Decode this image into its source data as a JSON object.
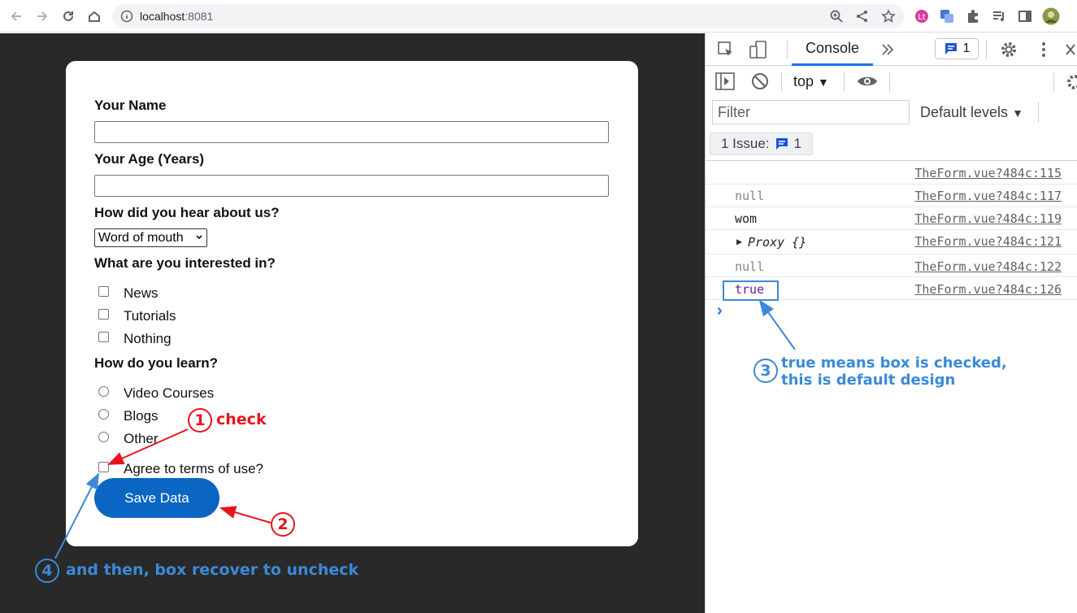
{
  "browser": {
    "url_host": "localhost",
    "url_port": ":8081"
  },
  "form": {
    "name_label": "Your Name",
    "age_label": "Your Age (Years)",
    "referrer_label": "How did you hear about us?",
    "referrer_selected": "Word of mouth",
    "interest_label": "What are you interested in?",
    "interests": [
      "News",
      "Tutorials",
      "Nothing"
    ],
    "learning_label": "How do you learn?",
    "learning_options": [
      "Video Courses",
      "Blogs",
      "Other"
    ],
    "terms_label": "Agree to terms of use?",
    "save_label": "Save Data"
  },
  "devtools": {
    "console_tab": "Console",
    "issues_badge": "1",
    "context": "top",
    "filter_placeholder": "Filter",
    "levels": "Default levels",
    "issue_bar_text": "1 Issue:",
    "issue_bar_count": "1",
    "logs": [
      {
        "value": "",
        "source": "TheForm.vue?484c:115"
      },
      {
        "value": "null",
        "source": "TheForm.vue?484c:117"
      },
      {
        "value": "wom",
        "source": "TheForm.vue?484c:119"
      },
      {
        "value": "Proxy {}",
        "source": "TheForm.vue?484c:121"
      },
      {
        "value": "null",
        "source": "TheForm.vue?484c:122"
      },
      {
        "value": "true",
        "source": "TheForm.vue?484c:126"
      }
    ],
    "prompt": "›"
  },
  "annotations": {
    "a1_num": "1",
    "a1_text": "check",
    "a2_num": "2",
    "a3_num": "3",
    "a3_line1": "true means box is checked,",
    "a3_line2": "this is default design",
    "a4_num": "4",
    "a4_text": "and then, box recover to uncheck",
    "red_color": "#e8141c",
    "blue_color": "#3a8ad8"
  }
}
